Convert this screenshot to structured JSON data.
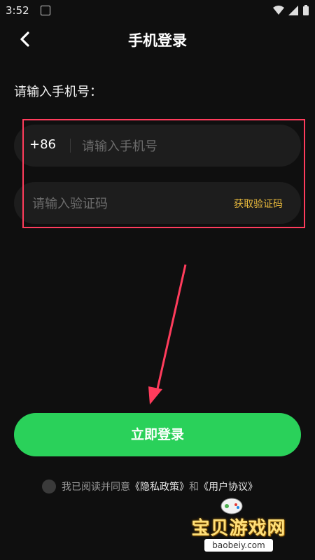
{
  "status_bar": {
    "time": "3:52"
  },
  "nav": {
    "title": "手机登录"
  },
  "form": {
    "prompt": "请输入手机号：",
    "country_code": "+86",
    "phone_placeholder": "请输入手机号",
    "code_placeholder": "请输入验证码",
    "get_code_label": "获取验证码"
  },
  "login_button": {
    "label": "立即登录"
  },
  "agreement": {
    "prefix": "我已阅读并同意",
    "privacy": "《隐私政策》",
    "and": "和",
    "terms": "《用户协议》"
  },
  "watermark": {
    "title": "宝贝游戏网",
    "url": "baobeiy.com"
  },
  "colors": {
    "accent_green": "#2ad15a",
    "highlight_red": "#ff3c5c",
    "get_code_yellow": "#e7b83c"
  }
}
